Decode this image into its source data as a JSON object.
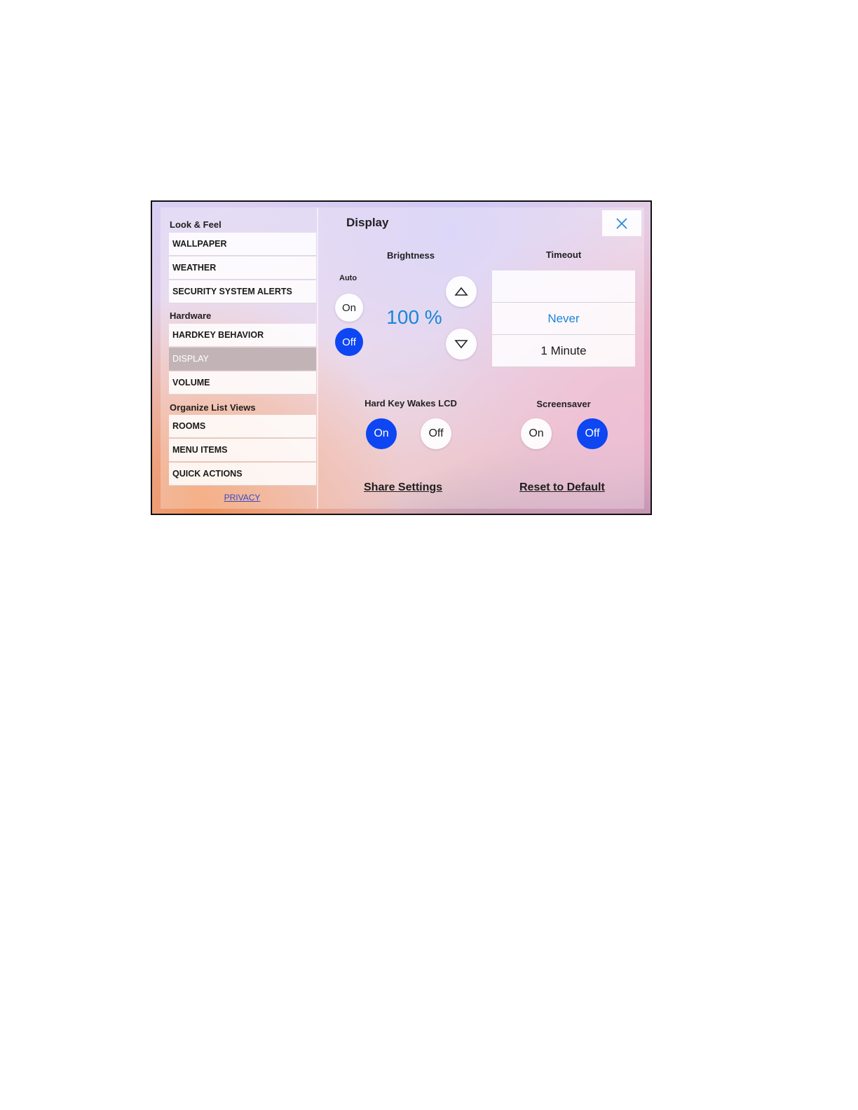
{
  "sidebar": {
    "sections": [
      {
        "label": "Look & Feel",
        "items": [
          "WALLPAPER",
          "WEATHER",
          "SECURITY SYSTEM ALERTS"
        ]
      },
      {
        "label": "Hardware",
        "items": [
          "HARDKEY BEHAVIOR",
          "DISPLAY",
          "VOLUME"
        ]
      },
      {
        "label": "Organize List Views",
        "items": [
          "ROOMS",
          "MENU ITEMS",
          "QUICK ACTIONS"
        ]
      }
    ],
    "active_item": "DISPLAY",
    "privacy_link": "PRIVACY"
  },
  "panel": {
    "title": "Display",
    "close_icon": "close-icon",
    "brightness": {
      "label": "Brightness",
      "auto_label": "Auto",
      "auto_on": "On",
      "auto_off": "Off",
      "auto_state": "Off",
      "value": "100 %",
      "up_icon": "triangle-up-icon",
      "down_icon": "triangle-down-icon"
    },
    "timeout": {
      "label": "Timeout",
      "options": [
        "",
        "Never",
        "1 Minute"
      ],
      "selected": "Never"
    },
    "hard_key_wakes_lcd": {
      "label": "Hard Key Wakes LCD",
      "on": "On",
      "off": "Off",
      "state": "On"
    },
    "screensaver": {
      "label": "Screensaver",
      "on": "On",
      "off": "Off",
      "state": "Off"
    },
    "share_settings": "Share Settings",
    "reset_to_default": "Reset to Default"
  },
  "colors": {
    "selected_toggle": "#0d46f2",
    "accent_text": "#1a86d9",
    "active_nav": "#c2b4b6",
    "privacy_link": "#3a46c4"
  }
}
